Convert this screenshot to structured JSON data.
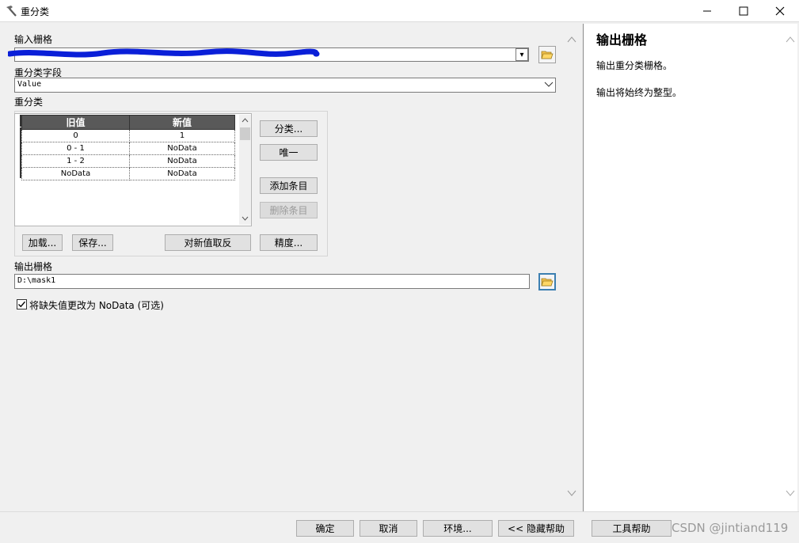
{
  "window": {
    "title": "重分类",
    "icons": {
      "app": "hammer-icon",
      "minimize": "minimize-icon",
      "maximize": "maximize-icon",
      "close": "close-icon"
    }
  },
  "input_raster": {
    "label": "输入栅格",
    "value": "",
    "dropdown_arrow": "▾"
  },
  "reclass_field": {
    "label": "重分类字段",
    "value": "Value"
  },
  "reclassification": {
    "label": "重分类",
    "columns": [
      "旧值",
      "新值"
    ],
    "rows": [
      {
        "old": "0",
        "new": "1"
      },
      {
        "old": "0 - 1",
        "new": "NoData"
      },
      {
        "old": "1 - 2",
        "new": "NoData"
      },
      {
        "old": "NoData",
        "new": "NoData"
      }
    ],
    "buttons": {
      "classify": "分类...",
      "unique": "唯一",
      "add_entry": "添加条目",
      "delete_entry": "删除条目",
      "load": "加载...",
      "save": "保存...",
      "reverse": "对新值取反",
      "precision": "精度..."
    }
  },
  "output_raster": {
    "label": "输出栅格",
    "value": "D:\\mask1"
  },
  "nodata_option": {
    "checked": true,
    "label": "将缺失值更改为 NoData (可选)"
  },
  "help": {
    "title": "输出栅格",
    "paragraphs": [
      "输出重分类栅格。",
      "输出将始终为整型。"
    ]
  },
  "footer": {
    "ok": "确定",
    "cancel": "取消",
    "environments": "环境...",
    "hide_help": "<< 隐藏帮助",
    "tool_help": "工具帮助",
    "watermark": "CSDN @jintiand119"
  }
}
